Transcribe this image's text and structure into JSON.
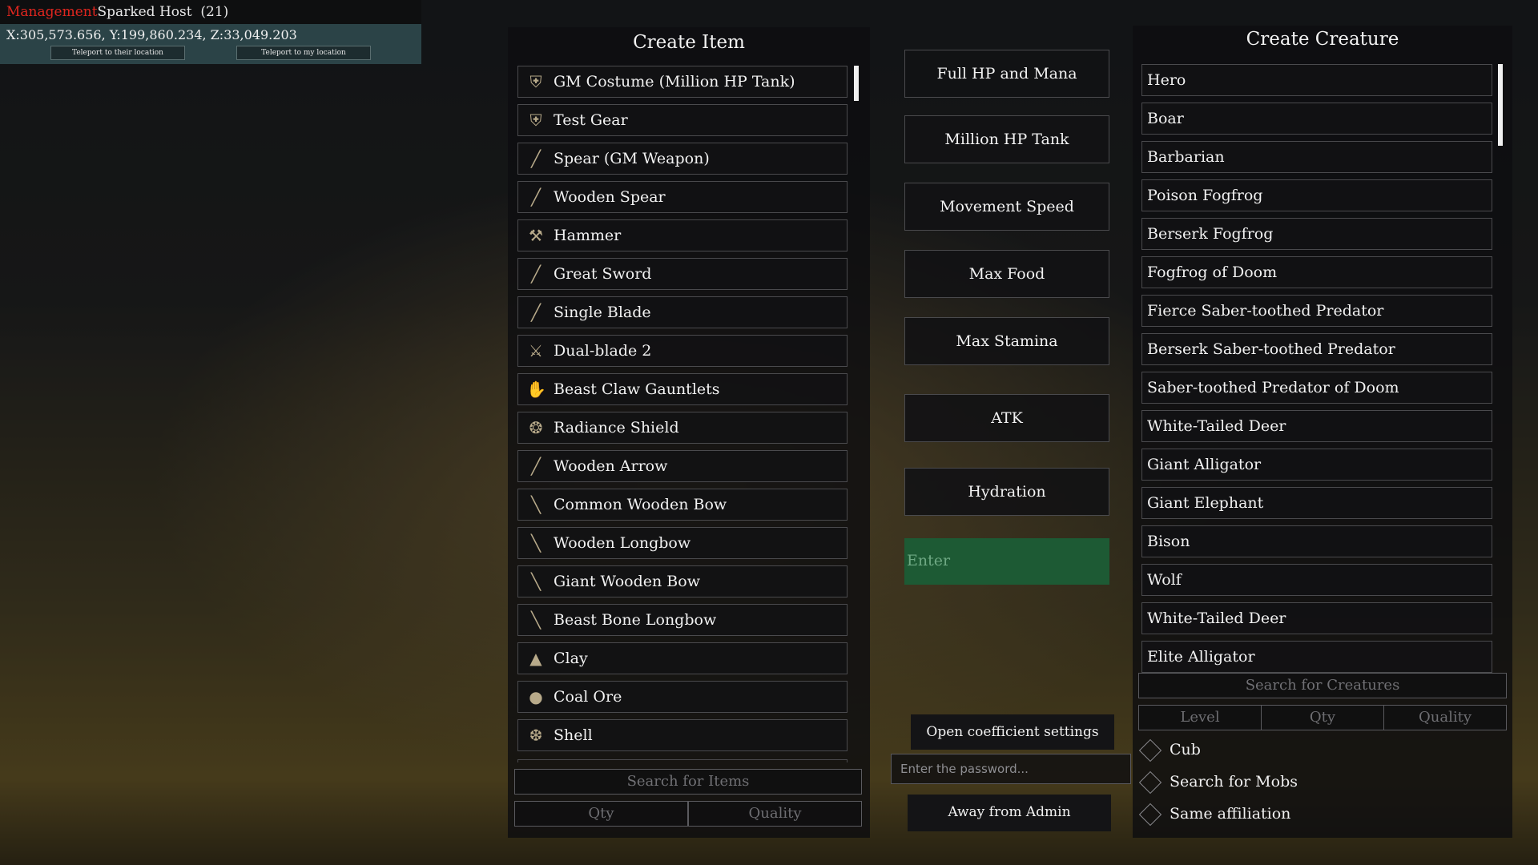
{
  "player": {
    "role": "Management",
    "name": "Sparked Host",
    "level": "(21)",
    "coords": "X:305,573.656, Y:199,860.234, Z:33,049.203",
    "teleport_to_them": "Teleport to their location",
    "teleport_to_me": "Teleport to my location"
  },
  "create_item": {
    "title": "Create Item",
    "items": [
      {
        "label": "GM Costume (Million HP Tank)",
        "icon": "armor-icon"
      },
      {
        "label": "Test Gear",
        "icon": "armor-icon"
      },
      {
        "label": "Spear (GM Weapon)",
        "icon": "spear-icon"
      },
      {
        "label": "Wooden Spear",
        "icon": "spear-icon"
      },
      {
        "label": "Hammer",
        "icon": "hammer-icon"
      },
      {
        "label": "Great Sword",
        "icon": "sword-icon"
      },
      {
        "label": "Single Blade",
        "icon": "blade-icon"
      },
      {
        "label": "Dual-blade 2",
        "icon": "dual-blade-icon"
      },
      {
        "label": "Beast Claw Gauntlets",
        "icon": "gauntlet-icon"
      },
      {
        "label": "Radiance Shield",
        "icon": "shield-icon"
      },
      {
        "label": "Wooden Arrow",
        "icon": "arrow-icon"
      },
      {
        "label": "Common Wooden Bow",
        "icon": "bow-icon"
      },
      {
        "label": "Wooden Longbow",
        "icon": "bow-icon"
      },
      {
        "label": "Giant Wooden Bow",
        "icon": "bow-icon"
      },
      {
        "label": "Beast Bone Longbow",
        "icon": "bow-icon"
      },
      {
        "label": "Clay",
        "icon": "clay-icon"
      },
      {
        "label": "Coal Ore",
        "icon": "ore-icon"
      },
      {
        "label": "Shell",
        "icon": "shell-icon"
      }
    ],
    "search_placeholder": "Search for Items",
    "qty_label": "Qty",
    "quality_label": "Quality"
  },
  "actions": {
    "full_hp": "Full HP and Mana",
    "million_hp": "Million HP Tank",
    "movement_speed": "Movement Speed",
    "max_food": "Max Food",
    "max_stamina": "Max Stamina",
    "atk": "ATK",
    "hydration": "Hydration",
    "enter": "Enter",
    "open_coeff": "Open coefficient settings",
    "password_placeholder": "Enter the password...",
    "away_from_admin": "Away from Admin"
  },
  "create_creature": {
    "title": "Create Creature",
    "creatures": [
      "Hero",
      "Boar",
      "Barbarian",
      "Poison Fogfrog",
      "Berserk Fogfrog",
      "Fogfrog of Doom",
      "Fierce Saber-toothed Predator",
      "Berserk Saber-toothed Predator",
      "Saber-toothed Predator of Doom",
      "White-Tailed Deer",
      "Giant Alligator",
      "Giant Elephant",
      "Bison",
      "Wolf",
      "White-Tailed Deer",
      "Elite Alligator"
    ],
    "search_placeholder": "Search for Creatures",
    "level_label": "Level",
    "qty_label": "Qty",
    "quality_label": "Quality",
    "options": [
      "Cub",
      "Search for Mobs",
      "Same affiliation"
    ]
  },
  "colors": {
    "role": "#e0261f",
    "enter_bg": "#1d5a34",
    "coords_bg": "#2b4347"
  }
}
